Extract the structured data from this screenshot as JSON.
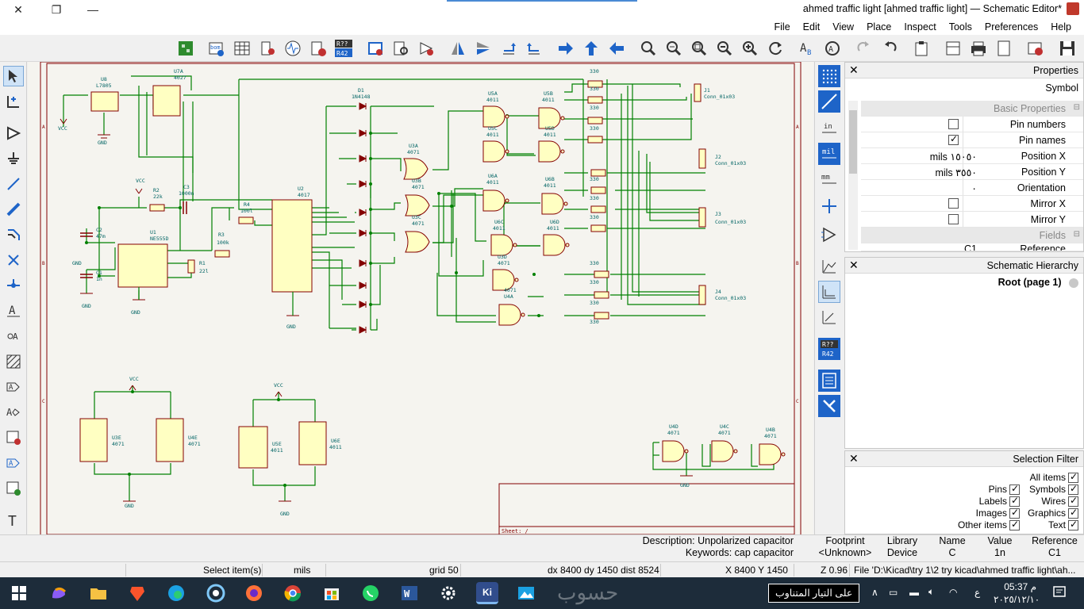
{
  "window": {
    "title": "ahmed traffic light [ahmed traffic light] — Schematic Editor*",
    "close_glyph": "✕",
    "restore_glyph": "❐",
    "minimize_glyph": "—"
  },
  "menu": [
    "Help",
    "Preferences",
    "Tools",
    "Inspect",
    "Place",
    "View",
    "Edit",
    "File"
  ],
  "properties_panel": {
    "title": "Properties",
    "subtitle": "Symbol",
    "section_basic": "Basic Properties",
    "section_fields": "Fields",
    "rows": [
      {
        "label": "Pin numbers",
        "type": "checkbox",
        "checked": false
      },
      {
        "label": "Pin names",
        "type": "checkbox",
        "checked": true
      },
      {
        "label": "Position X",
        "value": "mils ١٥٠٥٠"
      },
      {
        "label": "Position Y",
        "value": "mils ٣٥٥٠"
      },
      {
        "label": "Orientation",
        "value": "٠"
      },
      {
        "label": "Mirror X",
        "type": "checkbox",
        "checked": false
      },
      {
        "label": "Mirror Y",
        "type": "checkbox",
        "checked": false
      }
    ],
    "partial_row_left": "C1",
    "partial_row_right": "Reference"
  },
  "hierarchy_panel": {
    "title": "Schematic Hierarchy",
    "root": "Root (page 1)"
  },
  "selection_filter": {
    "title": "Selection Filter",
    "items_left": [
      {
        "label": "All items",
        "checked": true
      },
      {
        "label": "Symbols",
        "checked": true
      },
      {
        "label": "Wires",
        "checked": true
      },
      {
        "label": "Graphics",
        "checked": true
      },
      {
        "label": "Text",
        "checked": true
      }
    ],
    "items_right": [
      {
        "label": "Pins",
        "checked": true
      },
      {
        "label": "Labels",
        "checked": true
      },
      {
        "label": "Images",
        "checked": true
      },
      {
        "label": "Other items",
        "checked": true
      }
    ]
  },
  "infobar": {
    "description_label": "Description: Unpolarized capacitor",
    "keywords_label": "Keywords: cap capacitor",
    "footprint_h": "Footprint",
    "footprint_v": "<Unknown>",
    "library_h": "Library",
    "library_v": "Device",
    "name_h": "Name",
    "name_v": "C",
    "value_h": "Value",
    "value_v": "1n",
    "reference_h": "Reference",
    "reference_v": "C1"
  },
  "statusbar": {
    "action": "Select item(s)",
    "units": "mils",
    "grid": "grid 50",
    "delta": "dx 8400  dy 1450  dist 8524",
    "cursor": "X 8400  Y 1450",
    "zoom": "Z 0.96",
    "file": "File 'D:\\Kicad\\try 1\\2 try kicad\\ahmed traffic light\\ah..."
  },
  "taskbar": {
    "notification_text": "على التيار المتناوب",
    "time": "05:37 م",
    "date": "٢٠٢٥/١٢/١٠",
    "lang": "ع",
    "watermark": "حسوب",
    "kicad_label": "Ki"
  },
  "schematic": {
    "sheet_label": "Sheet: /",
    "labels": {
      "u8": "U8",
      "u8v": "L7805",
      "u7a": "U7A",
      "u7av": "4027",
      "u1": "U1",
      "u1v": "NE555D",
      "u2": "U2",
      "u2v": "4017",
      "r1": "R1",
      "r1v": "22l",
      "r2": "R2",
      "r2v": "22k",
      "r3": "R3",
      "r3v": "100k",
      "r4": "R4",
      "r4v": "100l",
      "c1": "C1",
      "c1v": "1n",
      "c2": "C2",
      "c2v": "47m",
      "c3": "C3",
      "c3v": "1000n",
      "vcc": "VCC",
      "gnd": "GND",
      "d1": "D1",
      "d_val": "1N4148",
      "u3a": "U3A",
      "u3b": "U3B",
      "u3c": "U3C",
      "u3d": "U3D",
      "v4071": "4071",
      "u5a": "U5A",
      "u5b": "U5B",
      "u5c": "U5C",
      "u5d": "U5D",
      "v4011": "4011",
      "u6a": "U6A",
      "u6b": "U6B",
      "u6c": "U6C",
      "u6d": "U6D",
      "u4a": "U4A",
      "u4b": "U4B",
      "u4c": "U4C",
      "u4d": "U4D",
      "u3e": "U3E",
      "u4e": "U4E",
      "u5e": "U5E",
      "u6e": "U6E",
      "j1": "J1",
      "j2": "J2",
      "j3": "J3",
      "j4": "J4",
      "conn": "Conn_01x03",
      "r330": "330"
    }
  },
  "colors": {
    "wire": "#008000",
    "symbol_body": "#ffffc2",
    "symbol_outline": "#840000",
    "text": "#006464",
    "canvas": "#f5f4ef",
    "accent_blue": "#1e64c8"
  }
}
